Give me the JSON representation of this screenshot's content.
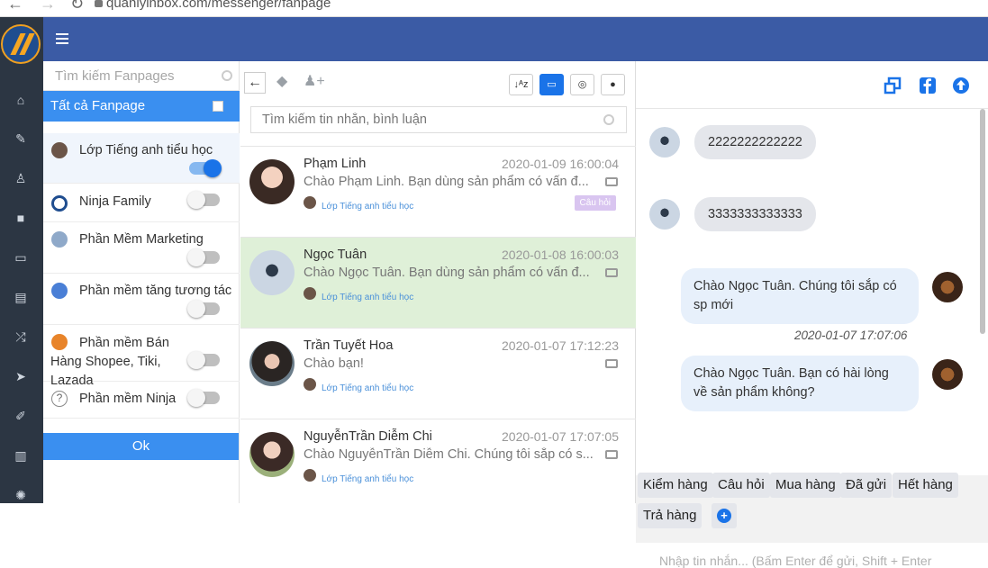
{
  "browser": {
    "url": "quanlyinbox.com/messenger/fanpage"
  },
  "rail": {
    "icons": [
      "home-icon",
      "wrench-icon",
      "user-icon",
      "cube-icon",
      "card-icon",
      "book-icon",
      "shuffle-icon",
      "send-icon",
      "paperclip-icon",
      "chart-icon",
      "gear-icon"
    ]
  },
  "fanpages": {
    "search_placeholder": "Tìm kiếm Fanpages",
    "all_label": "Tất cả Fanpage",
    "items": [
      {
        "name": "Lớp Tiếng anh tiểu học",
        "enabled": true
      },
      {
        "name": "Ninja Family",
        "enabled": false
      },
      {
        "name": "Phần Mềm Marketing",
        "enabled": false
      },
      {
        "name": "Phần mềm tăng tương tác",
        "enabled": false
      },
      {
        "name": "Phần mềm Bán Hàng Shopee, Tiki, Lazada",
        "enabled": false
      },
      {
        "name": "Phần mềm Ninja",
        "enabled": false
      }
    ],
    "ok_label": "Ok"
  },
  "conversations": {
    "search_placeholder": "Tìm kiếm tin nhắn, bình luận",
    "toolbar": {
      "sort_label": "↓ᴬz"
    },
    "items": [
      {
        "name": "Phạm Linh",
        "time": "2020-01-09 16:00:04",
        "preview": "Chào Phạm Linh. Bạn dùng sản phẩm có vấn đ...",
        "source": "Lớp Tiếng anh tiểu học",
        "tag": "Câu hỏi",
        "selected": false
      },
      {
        "name": "Ngọc Tuân",
        "time": "2020-01-08 16:00:03",
        "preview": "Chào Ngọc Tuân. Bạn dùng sản phẩm có vấn đ...",
        "source": "Lớp Tiếng anh tiểu học",
        "tag": "",
        "selected": true
      },
      {
        "name": "Trần Tuyết Hoa",
        "time": "2020-01-07 17:12:23",
        "preview": "Chào bạn!",
        "source": "Lớp Tiếng anh tiểu học",
        "tag": "",
        "selected": false
      },
      {
        "name": "NguyễnTrần Diễm Chi",
        "time": "2020-01-07 17:07:05",
        "preview": "Chào NguyễnTrần Diễm Chi. Chúng tôi sắp có s...",
        "source": "Lớp Tiếng anh tiểu học",
        "tag": "",
        "selected": false
      }
    ]
  },
  "chat": {
    "messages": [
      {
        "direction": "in",
        "text": "2222222222222"
      },
      {
        "direction": "in",
        "text": "3333333333333"
      },
      {
        "direction": "out",
        "text": "Chào Ngọc Tuân. Chúng tôi sắp có sp mới",
        "time": "2020-01-07 17:07:06"
      },
      {
        "direction": "out",
        "text": "Chào Ngọc Tuân. Bạn có hài lòng về sản phẩm không?"
      }
    ],
    "quick_replies": [
      "Kiểm hàng",
      "Câu hỏi",
      "Mua hàng",
      "Đã gửi",
      "Hết hàng",
      "Trả hàng"
    ],
    "input_placeholder": "Nhập tin nhắn... (Bấm Enter để gửi, Shift + Enter"
  },
  "colors": {
    "header": "#3b5ba5",
    "accent": "#3a8ff0",
    "rail": "#2c3643",
    "selected_row": "#dff0d8"
  }
}
